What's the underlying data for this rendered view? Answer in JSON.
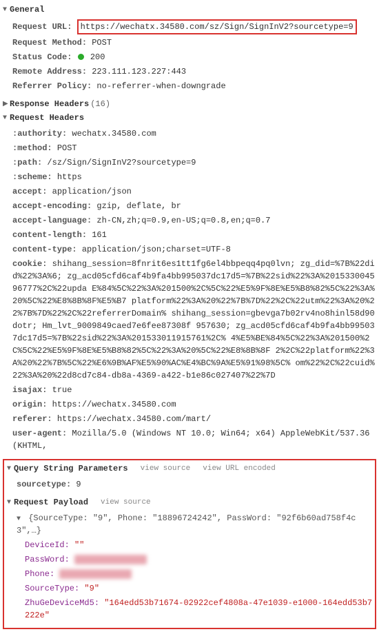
{
  "general": {
    "title": "General",
    "request_url": {
      "label": "Request URL:",
      "value": "https://wechatx.34580.com/sz/Sign/SignInV2?sourcetype=9"
    },
    "request_method": {
      "label": "Request Method:",
      "value": "POST"
    },
    "status_code": {
      "label": "Status Code:",
      "value": "200"
    },
    "remote_address": {
      "label": "Remote Address:",
      "value": "223.111.123.227:443"
    },
    "referrer_policy": {
      "label": "Referrer Policy:",
      "value": "no-referrer-when-downgrade"
    }
  },
  "response_headers": {
    "title": "Response Headers",
    "count": "(16)"
  },
  "request_headers": {
    "title": "Request Headers",
    "items": {
      "authority": {
        "label": ":authority:",
        "value": "wechatx.34580.com"
      },
      "method": {
        "label": ":method:",
        "value": "POST"
      },
      "path": {
        "label": ":path:",
        "value": "/sz/Sign/SignInV2?sourcetype=9"
      },
      "scheme": {
        "label": ":scheme:",
        "value": "https"
      },
      "accept": {
        "label": "accept:",
        "value": "application/json"
      },
      "accept_encoding": {
        "label": "accept-encoding:",
        "value": "gzip, deflate, br"
      },
      "accept_language": {
        "label": "accept-language:",
        "value": "zh-CN,zh;q=0.9,en-US;q=0.8,en;q=0.7"
      },
      "content_length": {
        "label": "content-length:",
        "value": "161"
      },
      "content_type": {
        "label": "content-type:",
        "value": "application/json;charset=UTF-8"
      },
      "cookie": {
        "label": "cookie:",
        "value": "shihang_session=8fnrit6es1tt1fg6el4bbpeqq4pq0lvn; zg_did=%7B%22did%22%3A%6; zg_acd05cfd6caf4b9fa4bb995037dc17d5=%7B%22sid%22%3A%201533004596777%2C%22upda E%84%5C%22%3A%201500%2C%5C%22%E5%9F%8E%E5%B8%82%5C%22%3A%20%5C%22%E8%8B%8F%E5%B7 platform%22%3A%20%22%7B%7D%22%2C%22utm%22%3A%20%22%7B%7D%22%2C%22referrerDomain% shihang_session=gbevga7b02rv4no8hinl58d90dotr; Hm_lvt_9009849caed7e6fee87308f 957630; zg_acd05cfd6caf4b9fa4bb995037dc17d5=%7B%22sid%22%3A%201533011915761%2C% 4%E5%BE%84%5C%22%3A%201500%2C%5C%22%E5%9F%8E%E5%B8%82%5C%22%3A%20%5C%22%E8%8B%8F 2%2C%22platform%22%3A%20%22%7B%5C%22%E6%9B%AF%E5%90%AC%E4%BC%9A%E5%91%98%5C% om%22%2C%22cuid%22%3A%20%22d8cd7c84-db8a-4369-a422-b1e86c027407%22%7D"
      },
      "isajax": {
        "label": "isajax:",
        "value": "true"
      },
      "origin": {
        "label": "origin:",
        "value": "https://wechatx.34580.com"
      },
      "referer": {
        "label": "referer:",
        "value": "https://wechatx.34580.com/mart/"
      },
      "user_agent": {
        "label": "user-agent:",
        "value": "Mozilla/5.0 (Windows NT 10.0; Win64; x64) AppleWebKit/537.36 (KHTML,"
      }
    }
  },
  "query_string": {
    "title": "Query String Parameters",
    "view_source": "view source",
    "view_url_encoded": "view URL encoded",
    "item": {
      "label": "sourcetype:",
      "value": "9"
    }
  },
  "payload": {
    "title": "Request Payload",
    "view_source": "view source",
    "summary": "{SourceType: \"9\", Phone: \"18896724242\", PassWord: \"92f6b60ad758f4c3\",…}",
    "device_id": {
      "label": "DeviceId:",
      "value": "\"\""
    },
    "password": {
      "label": "PassWord:",
      "value": "censored-xxxxx"
    },
    "phone": {
      "label": "Phone:",
      "value": "censored-xxxxx"
    },
    "source_type": {
      "label": "SourceType:",
      "value": "\"9\""
    },
    "zhuge": {
      "label": "ZhuGeDeviceMd5:",
      "value": "\"164edd53b71674-02922cef4808a-47e1039-e1000-164edd53b7222e\""
    }
  }
}
